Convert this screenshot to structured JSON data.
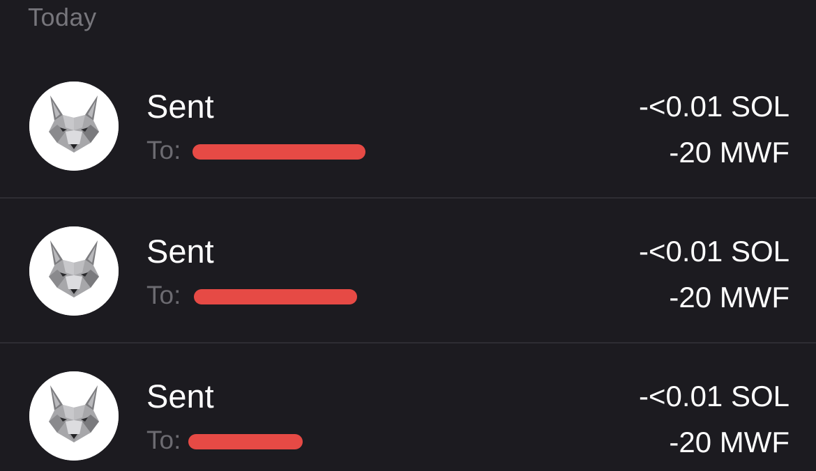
{
  "section": {
    "header": "Today"
  },
  "transactions": [
    {
      "title": "Sent",
      "to_label": "To:",
      "amount_primary": "-<0.01 SOL",
      "amount_secondary": "-20 MWF",
      "avatar_icon": "wolf-token-icon"
    },
    {
      "title": "Sent",
      "to_label": "To:",
      "amount_primary": "-<0.01 SOL",
      "amount_secondary": "-20 MWF",
      "avatar_icon": "wolf-token-icon"
    },
    {
      "title": "Sent",
      "to_label": "To:",
      "amount_primary": "-<0.01 SOL",
      "amount_secondary": "-20 MWF",
      "avatar_icon": "wolf-token-icon"
    }
  ],
  "colors": {
    "background": "#1c1b20",
    "divider": "#2e2d33",
    "muted_text": "#6c6b71",
    "redaction": "#e64a45"
  }
}
